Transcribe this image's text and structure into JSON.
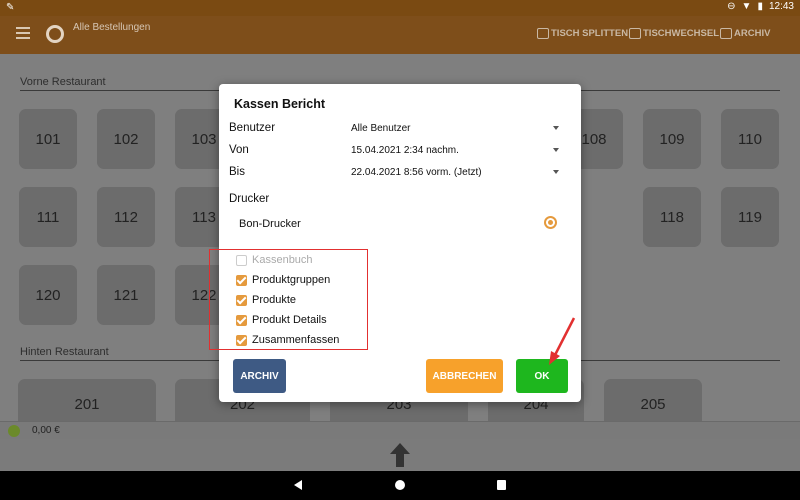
{
  "status_bar": {
    "time": "12:43"
  },
  "app_bar": {
    "title": "Alle Bestellungen",
    "actions": [
      "TISCH SPLITTEN",
      "TISCHWECHSEL",
      "ARCHIV"
    ]
  },
  "sections": {
    "vorne": "Vorne Restaurant",
    "hinten": "Hinten Restaurant"
  },
  "tables_vorne": [
    "101",
    "102",
    "103",
    "108",
    "109",
    "110",
    "111",
    "112",
    "113",
    "118",
    "119",
    "120",
    "121",
    "122"
  ],
  "tables_hinten": [
    "201",
    "202",
    "203",
    "204",
    "205"
  ],
  "footer": {
    "total": "0,00 €"
  },
  "dialog": {
    "title": "Kassen Bericht",
    "fields": [
      {
        "label": "Benutzer",
        "value": "Alle Benutzer"
      },
      {
        "label": "Von",
        "value": "15.04.2021 2:34 nachm."
      },
      {
        "label": "Bis",
        "value": "22.04.2021 8:56 vorm. (Jetzt)"
      }
    ],
    "printer_label": "Drucker",
    "printer_option": "Bon-Drucker",
    "checkboxes": [
      {
        "label": "Kassenbuch",
        "checked": false,
        "disabled": true
      },
      {
        "label": "Produktgruppen",
        "checked": true
      },
      {
        "label": "Produkte",
        "checked": true
      },
      {
        "label": "Produkt Details",
        "checked": true
      },
      {
        "label": "Zusammenfassen",
        "checked": true
      }
    ],
    "buttons": {
      "archiv": "ARCHIV",
      "abbrechen": "ABBRECHEN",
      "ok": "OK"
    }
  },
  "colors": {
    "accent": "#e59a3d",
    "archiv_button": "#3e5a84",
    "abbrechen_button": "#f7a12b",
    "ok_button": "#1eb71e",
    "annotation": "#e23030"
  }
}
